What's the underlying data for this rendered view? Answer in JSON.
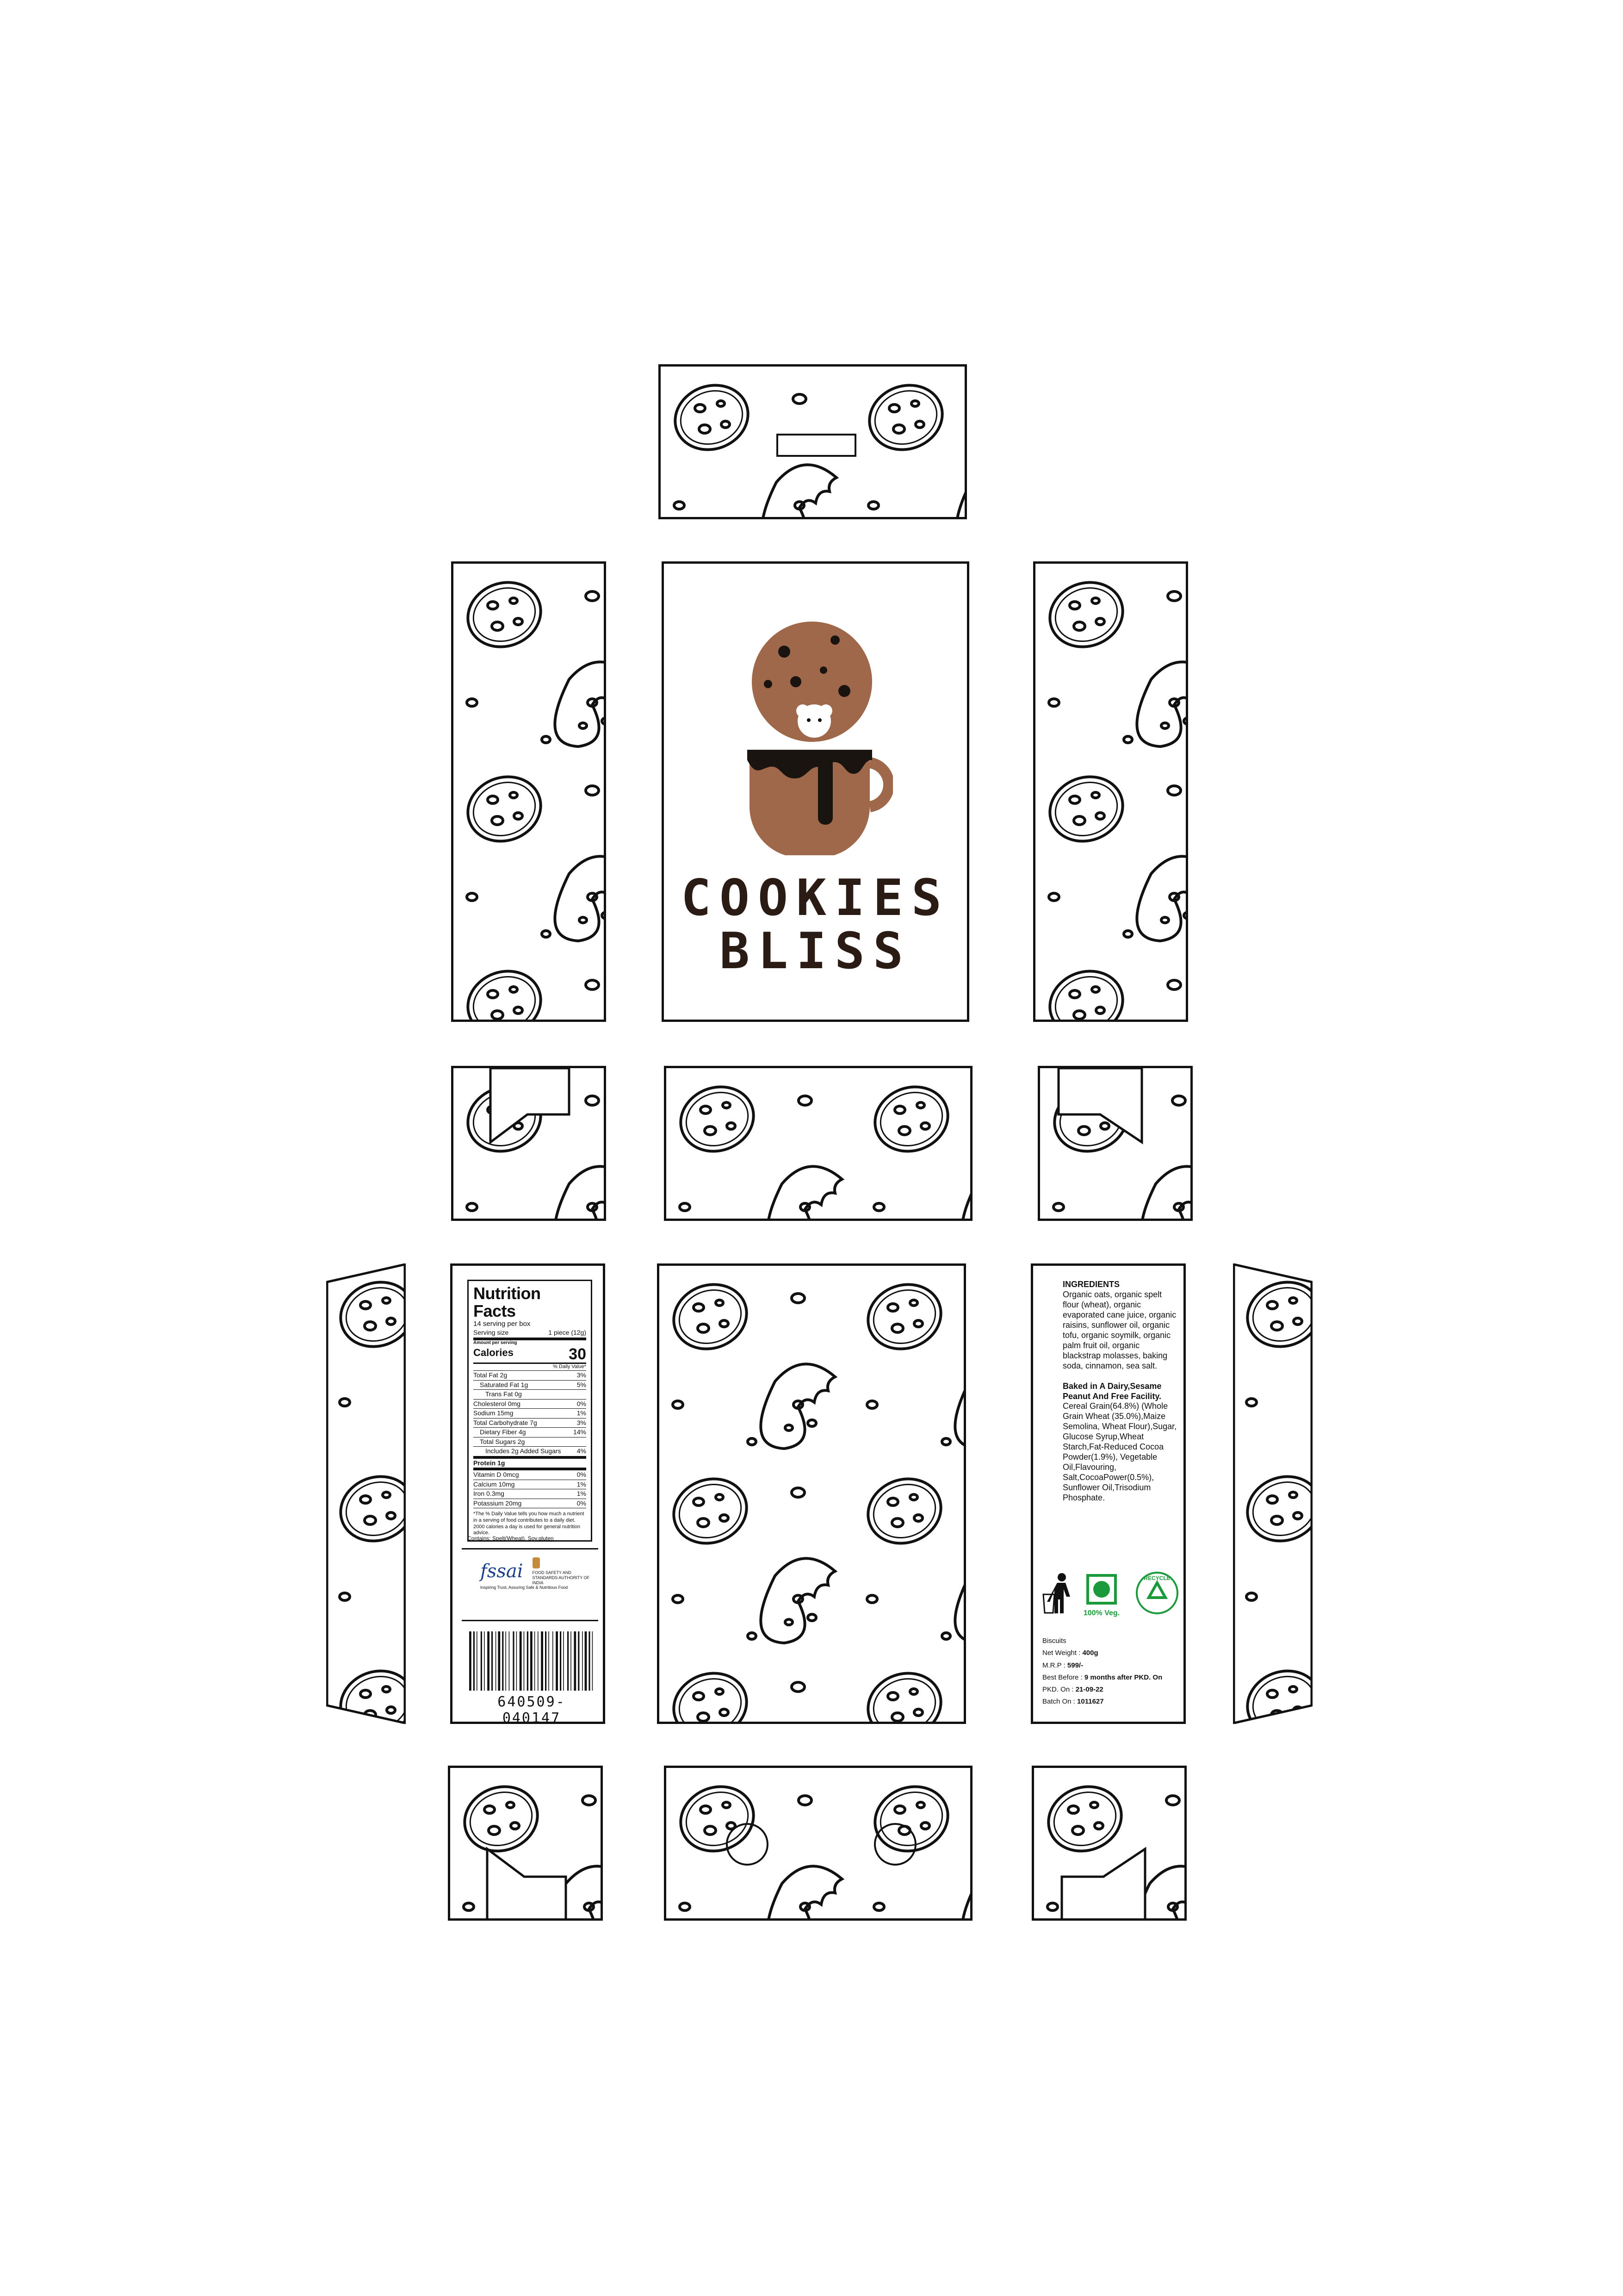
{
  "brand": {
    "line1": "COOKIES",
    "line2": "BLISS"
  },
  "nutrition": {
    "title": "Nutrition Facts",
    "servings_per_box": "14 serving per box",
    "serving_size_label": "Serving size",
    "serving_size_value": "1 piece (12g)",
    "amount_per_serving": "Amount per serving",
    "calories_label": "Calories",
    "calories_value": "30",
    "dv_header": "% Daily Value*",
    "rows": [
      {
        "label": "Total Fat 2g",
        "dv": "3%"
      },
      {
        "label": "Saturated Fat 1g",
        "dv": "5%"
      },
      {
        "label": "Trans Fat 0g",
        "dv": ""
      },
      {
        "label": "Cholesterol 0mg",
        "dv": "0%"
      },
      {
        "label": "Sodium 15mg",
        "dv": "1%"
      },
      {
        "label": "Total Carbohydrate 7g",
        "dv": "3%"
      },
      {
        "label": "Dietary Fiber 4g",
        "dv": "14%"
      },
      {
        "label": "Total Sugars 2g",
        "dv": ""
      },
      {
        "label": "Includes 2g Added Sugars",
        "dv": "4%"
      },
      {
        "label": "Protein 1g",
        "dv": ""
      },
      {
        "label": "Vitamin D 0mcg",
        "dv": "0%"
      },
      {
        "label": "Calcium 10mg",
        "dv": "1%"
      },
      {
        "label": "Iron 0.3mg",
        "dv": "1%"
      },
      {
        "label": "Potassium 20mg",
        "dv": "0%"
      }
    ],
    "footnote": "*The % Daily Value tells you how much a nutrient in a serving of food contributes to a daily diet. 2000 calories a day is used for general nutrition advice.",
    "contains": "Contains: Spelt(Wheat), Soy,gluten"
  },
  "fssai": {
    "logo": "fssai",
    "text": "FOOD SAFETY AND STANDARDS AUTHORITY OF INDIA",
    "tagline": "Inspiring Trust, Assuring Safe & Nutritious Food"
  },
  "barcode": {
    "number": "640509-040147"
  },
  "ingredients": {
    "heading": "INGREDIENTS",
    "list": "Organic oats, organic spelt flour (wheat), organic evaporated cane juice, organic raisins, sunflower oil, organic tofu, organic soymilk, organic palm fruit oil, organic blackstrap molasses, baking soda, cinnamon, sea salt.",
    "facility": "Baked in A Dairy,Sesame Peanut And Free Facility.",
    "composition": "Cereal Grain(64.8%) (Whole Grain Wheat (35.0%),Maize Semolina, Wheat Flour),Sugar, Glucose Syrup,Wheat Starch,Fat-Reduced Cocoa Powder(1.9%), Vegetable Oil,Flavouring, Salt,CocoaPower(0.5%), Sunflower Oil,Trisodium Phosphate."
  },
  "badges": {
    "veg": "100% Veg.",
    "recycle": "RECYCLE"
  },
  "info": {
    "product": "Biscuits",
    "net_weight_label": "Net Weight :",
    "net_weight": "400g",
    "mrp_label": "M.R.P :",
    "mrp": "599/-",
    "best_before_label": "Best Before :",
    "best_before": "9 months after PKD. On",
    "pkd_label": "PKD. On :",
    "pkd": "21-09-22",
    "batch_label": "Batch On :",
    "batch": "1011627"
  },
  "colors": {
    "cookie": "#a0684a",
    "cup": "#a0684a",
    "chocolate": "#1a1410",
    "veg_green": "#1a9a3a"
  }
}
